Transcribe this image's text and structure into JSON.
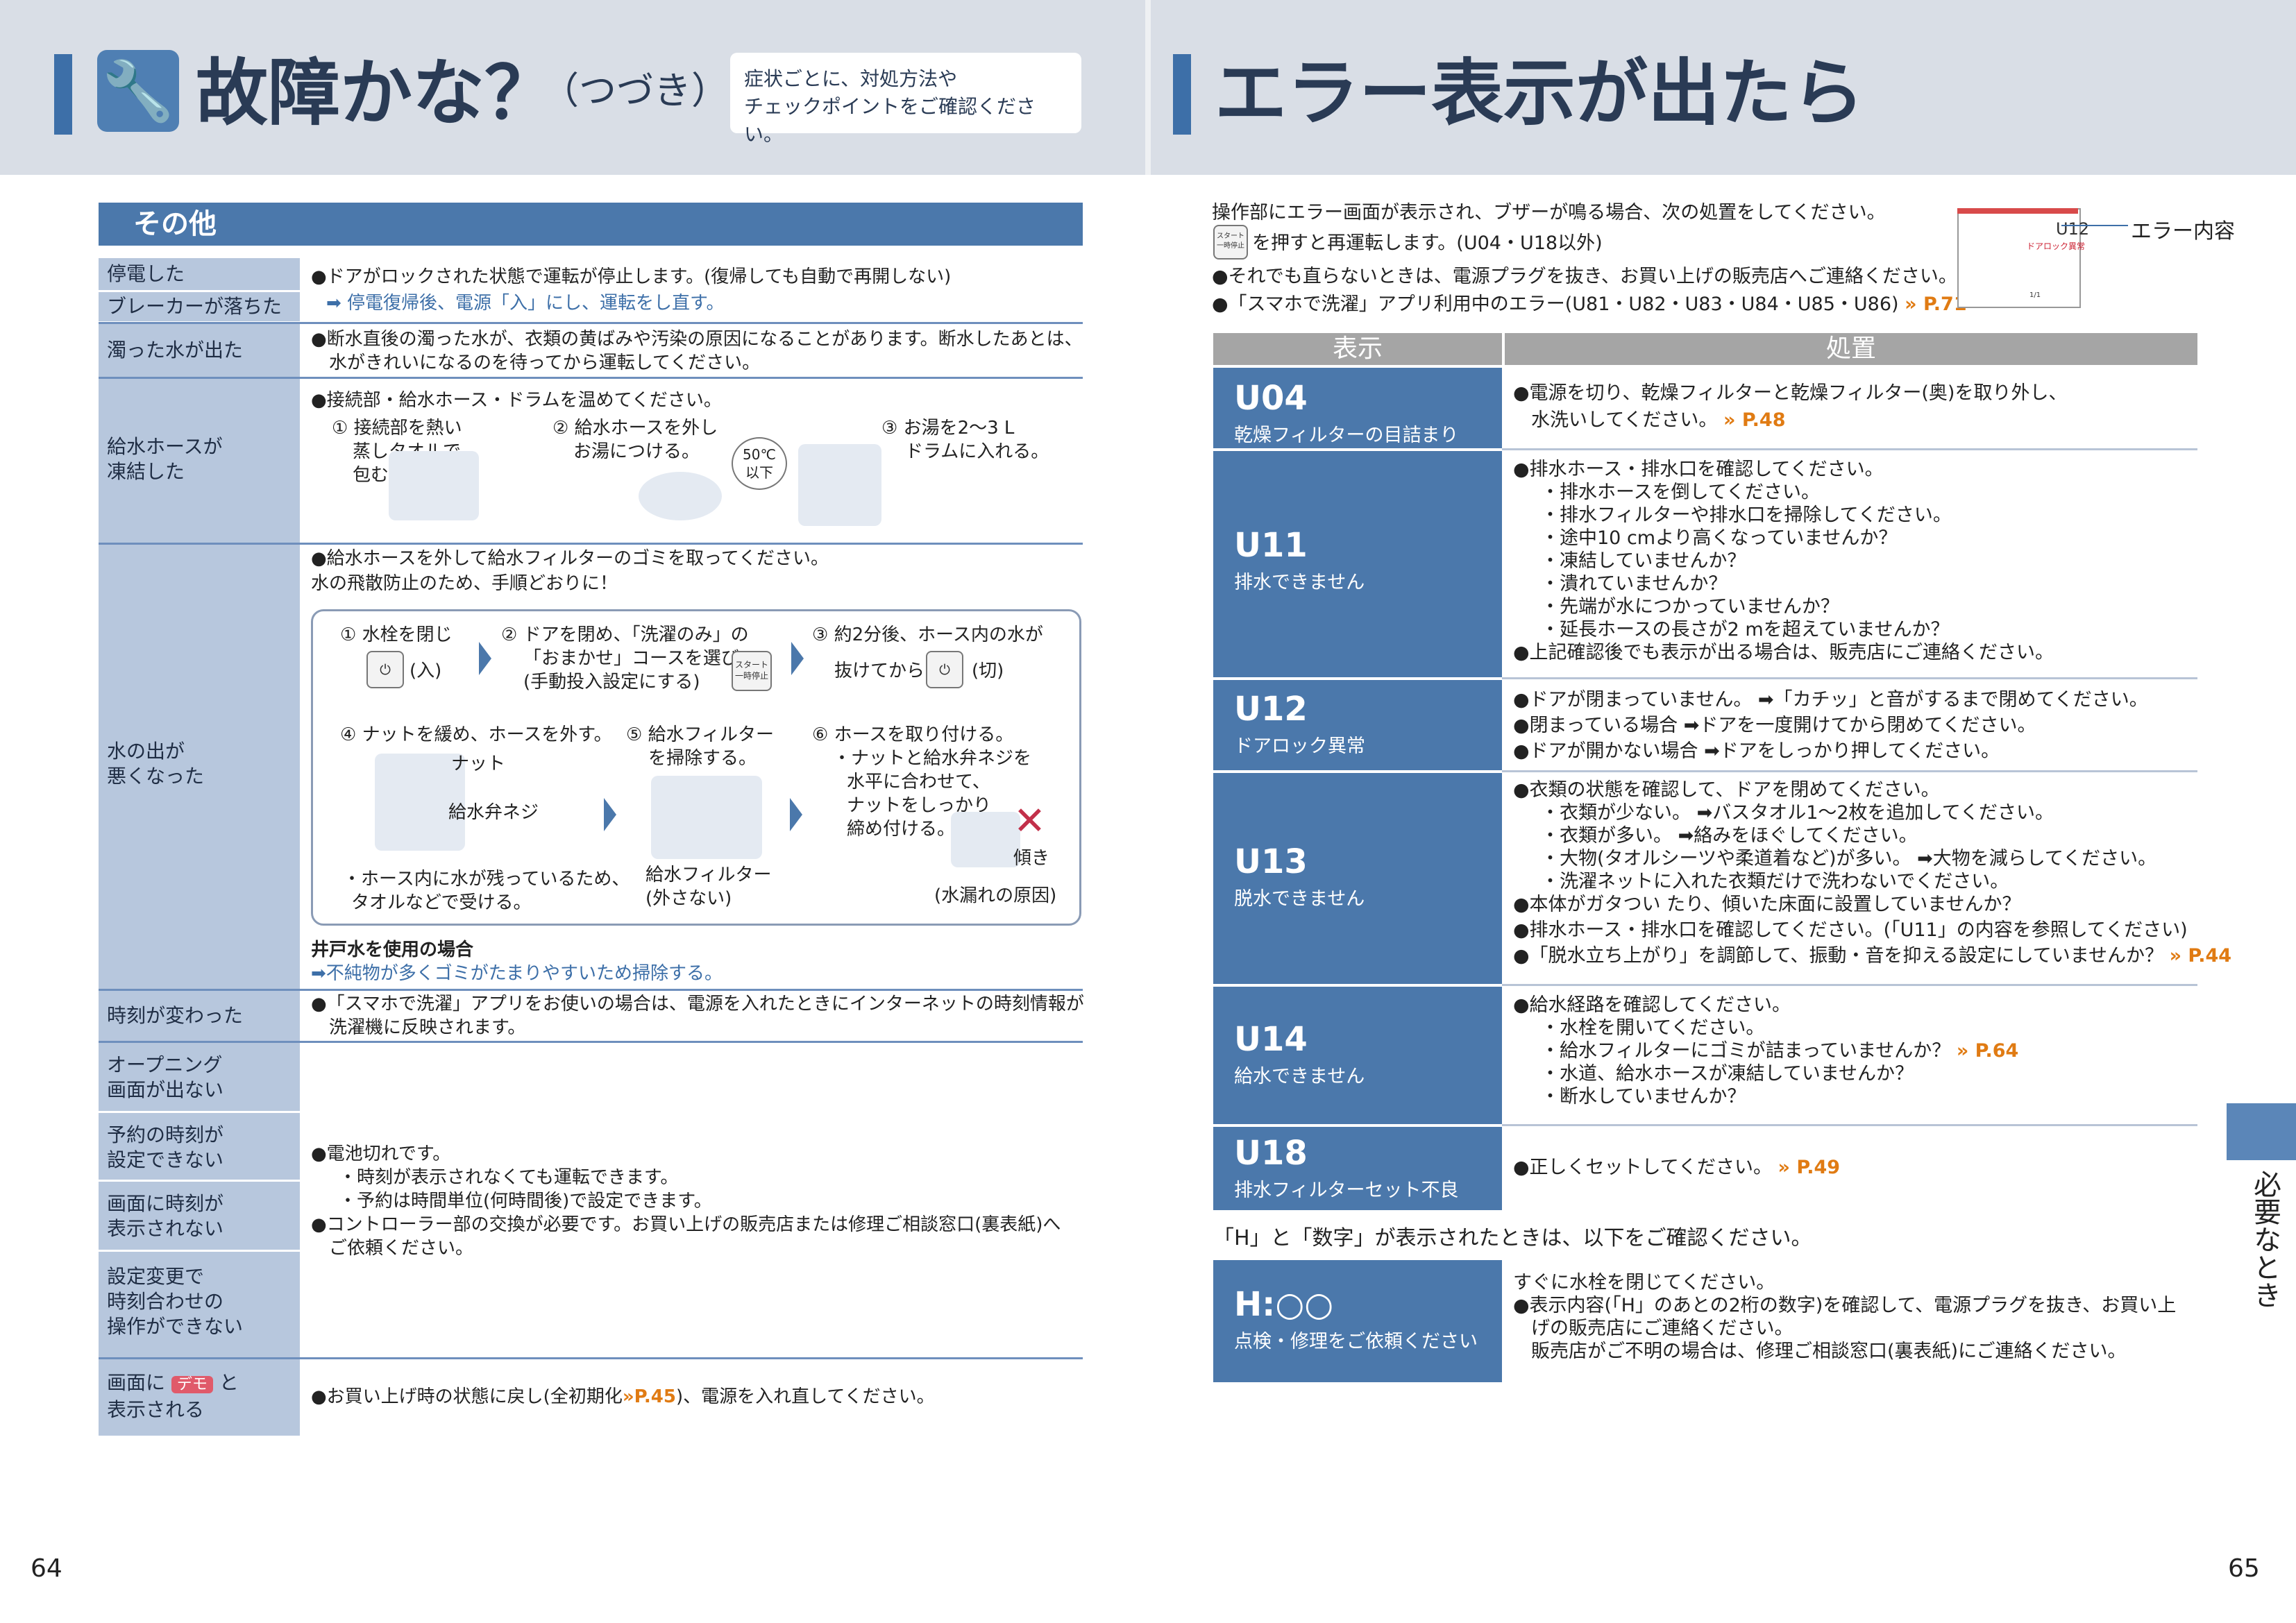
{
  "left": {
    "title": "故障かな？",
    "title_cont": "（つづき）",
    "hint": [
      "症状ごとに、対処方法や",
      "チェックポイントをご確認ください。"
    ],
    "section": "その他",
    "rows": {
      "power_outage": {
        "label": "停電した",
        "label2": "ブレーカーが落ちた",
        "text1": "●ドアがロックされた状態で運転が停止します。(復帰しても自動で再開しない)",
        "text2": "➡ 停電復帰後、電源「入」にし、運転をし直す。"
      },
      "dirty_water": {
        "label": "濁った水が出た",
        "text1": "●断水直後の濁った水が、衣類の黄ばみや汚染の原因になることがあります。断水したあとは、",
        "text2": "水がきれいになるのを待ってから運転してください。"
      },
      "frozen_hose": {
        "label": [
          "給水ホースが",
          "凍結した"
        ],
        "text1": "●接続部・給水ホース・ドラムを温めてください。",
        "step1": [
          "① 接続部を熱い",
          "蒸しタオルで",
          "包む。"
        ],
        "step2": [
          "② 給水ホースを外し",
          "お湯につける。"
        ],
        "temp": [
          "50℃",
          "以下"
        ],
        "step3": [
          "③ お湯を2～3 L",
          "ドラムに入れる。"
        ]
      },
      "water_poor": {
        "label": [
          "水の出が",
          "悪くなった"
        ],
        "text1": "●給水ホースを外して給水フィルターのゴミを取ってください。",
        "text2": "水の飛散防止のため、手順どおりに！",
        "s1": "① 水栓を閉じ",
        "s1_btn": "(入)",
        "s2": [
          "② ドアを閉め、「洗濯のみ」の",
          "「おまかせ」コースを選び",
          "(手動投入設定にする)"
        ],
        "s3": [
          "③ 約2分後、ホース内の水が",
          "抜けてから"
        ],
        "s3_btn": "(切)",
        "s4": "④ ナットを緩め、ホースを外す。",
        "nut": "ナット",
        "valve": "給水弁ネジ",
        "s4_note": [
          "・ホース内に水が残っているため、",
          "タオルなどで受ける。"
        ],
        "s5": [
          "⑤ 給水フィルター",
          "を掃除する。"
        ],
        "s5_note": [
          "給水フィルター",
          "(外さない)"
        ],
        "s6": [
          "⑥ ホースを取り付ける。",
          "・ナットと給水弁ネジを",
          "水平に合わせて、",
          "ナットをしっかり",
          "締め付ける。"
        ],
        "tilt": "傾き",
        "s6_note": "(水漏れの原因)",
        "well_title": "井戸水を使用の場合",
        "well_text": "➡不純物が多くゴミがたまりやすいため掃除する。"
      },
      "time_changed": {
        "label": "時刻が変わった",
        "text1": "●「スマホで洗濯」アプリをお使いの場合は、電源を入れたときにインターネットの時刻情報が",
        "text2": "洗濯機に反映されます。"
      },
      "opening": {
        "label": [
          "オープニング",
          "画面が出ない"
        ]
      },
      "reserve": {
        "label": [
          "予約の時刻が",
          "設定できない"
        ]
      },
      "screen_time": {
        "label": [
          "画面に時刻が",
          "表示されない"
        ]
      },
      "setting_change": {
        "label": [
          "設定変更で",
          "時刻合わせの",
          "操作ができない"
        ]
      },
      "battery": [
        "●電池切れです。",
        "・時刻が表示されなくても運転できます。",
        "・予約は時間単位(何時間後)で設定できます。",
        "●コントローラー部の交換が必要です。お買い上げの販売店または修理ご相談窓口(裏表紙)へ",
        "ご依頼ください。"
      ],
      "demo": {
        "label_a": "画面に",
        "badge": "デモ",
        "label_b": "と",
        "label_c": "表示される",
        "text1": "●お買い上げ時の状態に戻し(全初期化",
        "ref": "P.45",
        "text2": ")、電源を入れ直してください。"
      }
    },
    "start_btn": [
      "スタート",
      "一時停止"
    ],
    "page_number": "64"
  },
  "right": {
    "title": "エラー表示が出たら",
    "intro1": "操作部にエラー画面が表示され、ブザーが鳴る場合、次の処置をしてください。",
    "intro2": "を押すと再運転します。(U04・U18以外)",
    "intro3": "●それでも直らないときは、電源プラグを抜き、お買い上げの販売店へご連絡ください。",
    "intro4": "●「スマホで洗濯」アプリ利用中のエラー(U81・U82・U83・U84・U85・U86)",
    "intro4_ref": "P.71",
    "thumb_code": "U12",
    "thumb_sub": "ドアロック異常",
    "thumb_page": "1/1",
    "callout": "エラー内容",
    "col_display": "表示",
    "col_action": "処置",
    "errors": {
      "u04": {
        "code": "U04",
        "desc": "乾燥フィルターの目詰まり",
        "lines": [
          "●電源を切り、乾燥フィルターと乾燥フィルター(奥)を取り外し、",
          "水洗いしてください。"
        ],
        "ref": "P.48"
      },
      "u11": {
        "code": "U11",
        "desc": "排水できません",
        "lines": [
          "●排水ホース・排水口を確認してください。",
          "・排水ホースを倒してください。",
          "・排水フィルターや排水口を掃除してください。",
          "・途中10 cmより高くなっていませんか？",
          "・凍結していませんか？",
          "・潰れていませんか？",
          "・先端が水につかっていませんか？",
          "・延長ホースの長さが2 mを超えていませんか？",
          "●上記確認後でも表示が出る場合は、販売店にご連絡ください。"
        ]
      },
      "u12": {
        "code": "U12",
        "desc": "ドアロック異常",
        "lines": [
          "●ドアが閉まっていません。 ➡「カチッ」と音がするまで閉めてください。",
          "●閉まっている場合 ➡ドアを一度開けてから閉めてください。",
          "●ドアが開かない場合 ➡ドアをしっかり押してください。"
        ]
      },
      "u13": {
        "code": "U13",
        "desc": "脱水できません",
        "lines": [
          "●衣類の状態を確認して、ドアを閉めてください。",
          "・衣類が少ない。 ➡バスタオル1～2枚を追加してください。",
          "・衣類が多い。 ➡絡みをほぐしてください。",
          "・大物(タオルシーツや柔道着など)が多い。 ➡大物を減らしてください。",
          "・洗濯ネットに入れた衣類だけで洗わないでください。",
          "●本体がガタつい たり、傾いた床面に設置していませんか？",
          "●排水ホース・排水口を確認してください。(「U11」の内容を参照してください)",
          "●「脱水立ち上がり」を調節して、振動・音を抑える設定にしていませんか？"
        ],
        "ref": "P.44"
      },
      "u14": {
        "code": "U14",
        "desc": "給水できません",
        "lines": [
          "●給水経路を確認してください。",
          "・水栓を開いてください。",
          "・給水フィルターにゴミが詰まっていませんか？",
          "・水道、給水ホースが凍結していませんか？",
          "・断水していませんか？"
        ],
        "ref": "P.64"
      },
      "u18": {
        "code": "U18",
        "desc": "排水フィルターセット不良",
        "lines": [
          "●正しくセットしてください。"
        ],
        "ref": "P.49"
      }
    },
    "h_note": "「H」と「数字」が表示されたときは、以下をご確認ください。",
    "h_error": {
      "code": "H:○○",
      "desc": "点検・修理をご依頼ください",
      "lines": [
        "すぐに水栓を閉じてください。",
        "●表示内容(「H」のあとの2桁の数字)を確認して、電源プラグを抜き、お買い上",
        "げの販売店にご連絡ください。",
        "販売店がご不明の場合は、修理ご相談窓口(裏表紙)にご連絡ください。"
      ]
    },
    "side_tab": "必要なとき",
    "page_number": "65"
  },
  "colors": {
    "accent": "#3d6fa8",
    "label_bg": "#b7c7dd",
    "code_bg": "#4b78ab",
    "ref": "#e07b13"
  }
}
